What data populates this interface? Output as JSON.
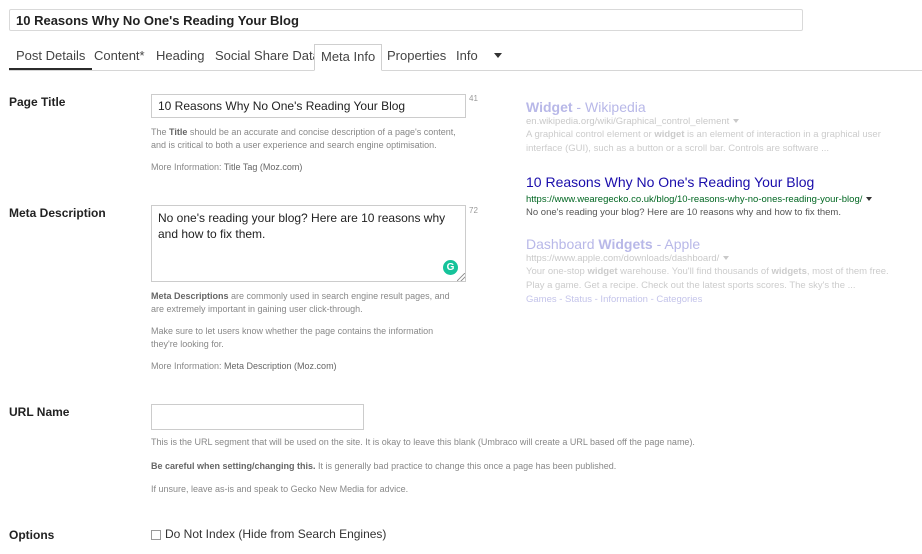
{
  "header": {
    "post_title": "10 Reasons Why No One's Reading Your Blog"
  },
  "tabs": [
    {
      "label": "Post Details"
    },
    {
      "label": "Content*"
    },
    {
      "label": "Heading"
    },
    {
      "label": "Social Share Data"
    },
    {
      "label": "Meta Info"
    },
    {
      "label": "Properties"
    },
    {
      "label": "Info"
    }
  ],
  "page_title": {
    "label": "Page Title",
    "value": "10 Reasons Why No One's Reading Your Blog",
    "counter": "41",
    "help_1a": "The ",
    "help_1b": "Title",
    "help_1c": " should be an accurate and concise description of a page's content,",
    "help_2": "and is critical to both a user experience and search engine optimisation.",
    "more_prefix": "More Information: ",
    "more_link": "Title Tag (Moz.com)"
  },
  "meta_description": {
    "label": "Meta Description",
    "value": "No one's reading your blog? Here are 10 reasons why and how to fix them.",
    "counter": "72",
    "help_1a": "Meta Descriptions",
    "help_1b": " are commonly used in search engine result pages, and",
    "help_2": "are extremely important in gaining user click-through.",
    "help_3": "Make sure to let users know whether the page contains the information",
    "help_4": "they're looking for.",
    "more_prefix": "More Information: ",
    "more_link": "Meta Description (Moz.com)"
  },
  "url_name": {
    "label": "URL Name",
    "value": "",
    "help_1": "This is the URL segment that will be used on the site. It is okay to leave this blank (Umbraco will create a URL based off the page name).",
    "help_2a": "Be careful when setting/changing this.",
    "help_2b": " It is generally bad practice to change this once a page has been published.",
    "help_3": "If unsure, leave as-is and speak to Gecko New Media for advice."
  },
  "options": {
    "label": "Options",
    "do_not_index": "Do Not Index (Hide from Search Engines)"
  },
  "serp": {
    "result1": {
      "title_a": "Widget",
      "title_b": " - Wikipedia",
      "url": "en.wikipedia.org/wiki/Graphical_control_element",
      "desc_a": "A graphical control element or ",
      "desc_b": "widget",
      "desc_c": " is an element of interaction in a graphical user",
      "desc_d": "interface (GUI), such as a button or a scroll bar. Controls are software ..."
    },
    "result2": {
      "title": "10 Reasons Why No One's Reading Your Blog",
      "url": "https://www.wearegecko.co.uk/blog/10-reasons-why-no-ones-reading-your-blog/",
      "desc": "No one's reading your blog? Here are 10 reasons why and how to fix them."
    },
    "result3": {
      "title_a": "Dashboard ",
      "title_b": "Widgets",
      "title_c": " - Apple",
      "url": "https://www.apple.com/downloads/dashboard/",
      "desc_1a": "Your one-stop ",
      "desc_1b": "widget",
      "desc_1c": " warehouse. You'll find thousands of ",
      "desc_1d": "widgets",
      "desc_1e": ", most of them free.",
      "desc_2": "Play a game. Get a recipe. Check out the latest sports scores. The sky's the ...",
      "links": "Games - Status - Information - Categories"
    }
  }
}
